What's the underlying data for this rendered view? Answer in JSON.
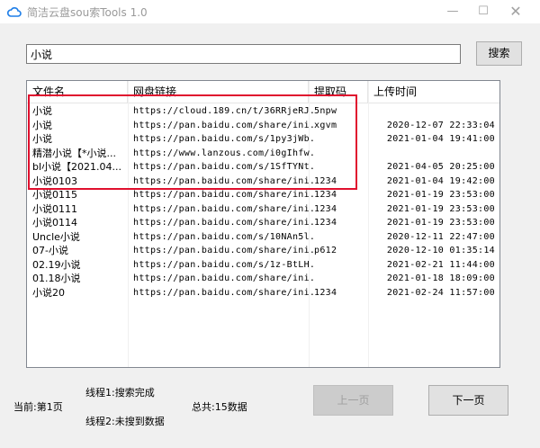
{
  "window": {
    "title": "简洁云盘sou索Tools 1.0",
    "controls": {
      "minimize": "—",
      "maximize": "☐",
      "close": "✕"
    }
  },
  "search": {
    "query": "小说",
    "button_label": "搜索"
  },
  "table": {
    "columns": [
      "文件名",
      "网盘链接",
      "提取码",
      "上传时间"
    ],
    "rows": [
      {
        "name": "小说",
        "link": "https://cloud.189.cn/t/36RRjeRJ...",
        "code": "5npw",
        "time": ""
      },
      {
        "name": "小说",
        "link": "https://pan.baidu.com/share/ini...",
        "code": "xgvm",
        "time": "2020-12-07 22:33:04"
      },
      {
        "name": "小说",
        "link": "https://pan.baidu.com/s/1py3jWb...",
        "code": "",
        "time": "2021-01-04 19:41:00"
      },
      {
        "name": "精潜小说【*小说...",
        "link": "https://www.lanzous.com/i0gIhfw...",
        "code": "",
        "time": ""
      },
      {
        "name": "bl小说【2021.04...",
        "link": "https://pan.baidu.com/s/1SfTYNt...",
        "code": "",
        "time": "2021-04-05 20:25:00"
      },
      {
        "name": "小说0103",
        "link": "https://pan.baidu.com/share/ini...",
        "code": "1234",
        "time": "2021-01-04 19:42:00"
      },
      {
        "name": "小说0115",
        "link": "https://pan.baidu.com/share/ini...",
        "code": "1234",
        "time": "2021-01-19 23:53:00"
      },
      {
        "name": "小说0111",
        "link": "https://pan.baidu.com/share/ini...",
        "code": "1234",
        "time": "2021-01-19 23:53:00"
      },
      {
        "name": "小说0114",
        "link": "https://pan.baidu.com/share/ini...",
        "code": "1234",
        "time": "2021-01-19 23:53:00"
      },
      {
        "name": "Uncle小说",
        "link": "https://pan.baidu.com/s/10NAn5l...",
        "code": "",
        "time": "2020-12-11 22:47:00"
      },
      {
        "name": "07-小说",
        "link": "https://pan.baidu.com/share/ini...",
        "code": "p612",
        "time": "2020-12-10 01:35:14"
      },
      {
        "name": "02.19小说",
        "link": "https://pan.baidu.com/s/1z-BtLH...",
        "code": "",
        "time": "2021-02-21 11:44:00"
      },
      {
        "name": "01.18小说",
        "link": "https://pan.baidu.com/share/ini...",
        "code": "",
        "time": "2021-01-18 18:09:00"
      },
      {
        "name": "小说20",
        "link": "https://pan.baidu.com/share/ini...",
        "code": "1234",
        "time": "2021-02-24 11:57:00"
      }
    ]
  },
  "status": {
    "current_page": "当前:第1页",
    "thread1": "线程1:搜索完成",
    "thread2": "线程2:未搜到数据",
    "total": "总共:15数据"
  },
  "pager": {
    "prev_label": "上一页",
    "next_label": "下一页"
  },
  "colors": {
    "highlight_border": "#e0102e",
    "app_icon": "#1e7ee8"
  },
  "icons": {
    "app": "cloud-icon"
  }
}
